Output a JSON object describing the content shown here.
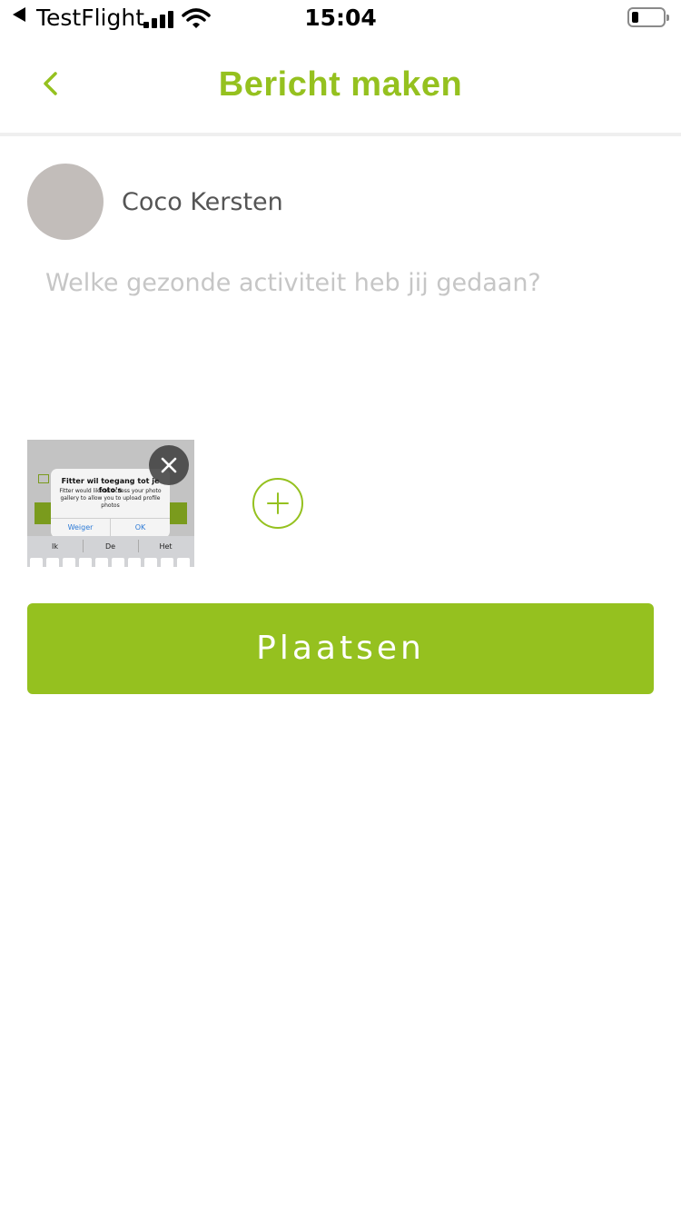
{
  "status_bar": {
    "back_app": "TestFlight",
    "time": "15:04"
  },
  "header": {
    "title": "Bericht maken",
    "back_icon": "chevron-left-icon"
  },
  "user": {
    "name": "Coco Kersten"
  },
  "composer": {
    "placeholder": "Welke gezonde activiteit heb jij gedaan?",
    "value": ""
  },
  "attachment": {
    "dialog_title": "Fitter wil toegang tot je foto's",
    "dialog_body": "Fitter would like to access your photo gallery to allow you to upload profile photos",
    "deny_label": "Weiger",
    "ok_label": "OK",
    "suggestions": [
      "Ik",
      "De",
      "Het"
    ],
    "remove_icon": "close-icon"
  },
  "add_photo_icon": "plus-icon",
  "submit": {
    "label": "Plaatsen"
  },
  "colors": {
    "accent": "#95c11f",
    "avatar": "#c2bdba"
  }
}
